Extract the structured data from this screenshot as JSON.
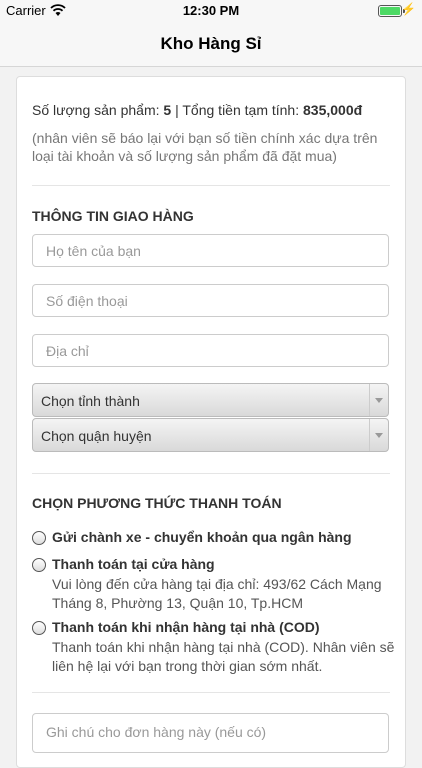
{
  "status_bar": {
    "carrier": "Carrier",
    "time": "12:30 PM",
    "bolt": "⚡"
  },
  "nav": {
    "title": "Kho Hàng Sỉ"
  },
  "summary": {
    "count_label": "Số lượng sản phẩm:",
    "count_value": "5",
    "separator": "|",
    "total_label": "Tổng tiền tạm tính:",
    "total_value": "835,000đ",
    "note": "(nhân viên sẽ báo lại với bạn số tiền chính xác dựa trên loại tài khoản và số lượng sản phẩm đã đặt mua)"
  },
  "shipping": {
    "title": "THÔNG TIN GIAO HÀNG",
    "name_placeholder": "Họ tên của bạn",
    "phone_placeholder": "Số điện thoại",
    "address_placeholder": "Địa chỉ",
    "province_select": "Chọn tỉnh thành",
    "district_select": "Chọn quận huyện"
  },
  "payment": {
    "title": "CHỌN PHƯƠNG THỨC THANH TOÁN",
    "options": [
      {
        "title": "Gửi chành xe - chuyển khoản qua ngân hàng",
        "desc": ""
      },
      {
        "title": "Thanh toán tại cửa hàng",
        "desc": "Vui lòng đến cửa hàng tại địa chỉ: 493/62 Cách Mạng Tháng 8, Phường 13, Quận 10, Tp.HCM"
      },
      {
        "title": "Thanh toán khi nhận hàng tại nhà (COD)",
        "desc": "Thanh toán khi nhận hàng tại nhà (COD). Nhân viên sẽ liên hệ lại với bạn trong thời gian sớm nhất."
      }
    ]
  },
  "order_note": {
    "placeholder": "Ghi chú cho đơn hàng này (nếu có)"
  }
}
